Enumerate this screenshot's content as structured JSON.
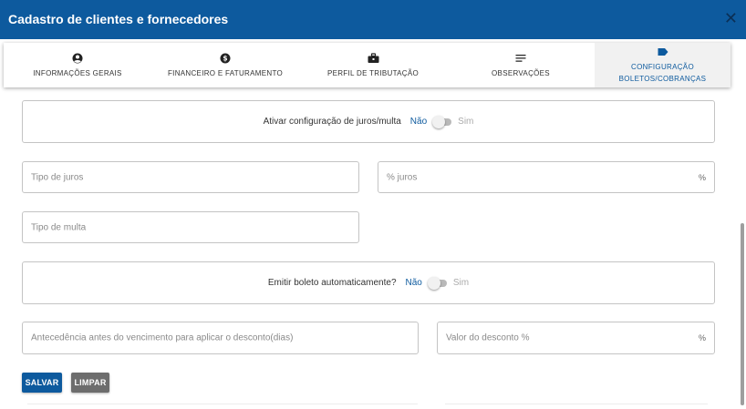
{
  "dialog": {
    "title": "Cadastro de clientes e fornecedores",
    "close_icon": "close-icon"
  },
  "tabs": [
    {
      "label": "INFORMAÇÕES GERAIS",
      "icon": "account-circle-icon"
    },
    {
      "label": "FINANCEIRO E FATURAMENTO",
      "icon": "dollar-circle-icon"
    },
    {
      "label": "PERFIL DE TRIBUTAÇÃO",
      "icon": "briefcase-icon"
    },
    {
      "label": "OBSERVAÇÕES",
      "icon": "notes-lines-icon"
    },
    {
      "label_line1": "CONFIGURAÇÃO",
      "label_line2": "BOLETOS/COBRANÇAS",
      "icon": "label-tag-icon",
      "active": true
    }
  ],
  "interest": {
    "label": "Ativar configuração de juros/multa",
    "off_label": "Não",
    "on_label": "Sim",
    "enabled": false
  },
  "fields": {
    "interest_type_placeholder": "Tipo de juros",
    "interest_pct_placeholder": "% juros",
    "interest_pct_suffix": "%",
    "fine_type_placeholder": "Tipo de multa",
    "advance_days_placeholder": "Antecedência antes do vencimento para aplicar o desconto(dias)",
    "discount_value_placeholder": "Valor do desconto %",
    "discount_value_suffix": "%"
  },
  "auto_boleto": {
    "label": "Emitir boleto automaticamente?",
    "off_label": "Não",
    "on_label": "Sim",
    "enabled": false
  },
  "actions": {
    "save_label": "SALVAR",
    "clear_label": "LIMPAR"
  },
  "colors": {
    "primary": "#0d5a9e",
    "secondary_button": "#6d6d6d"
  }
}
